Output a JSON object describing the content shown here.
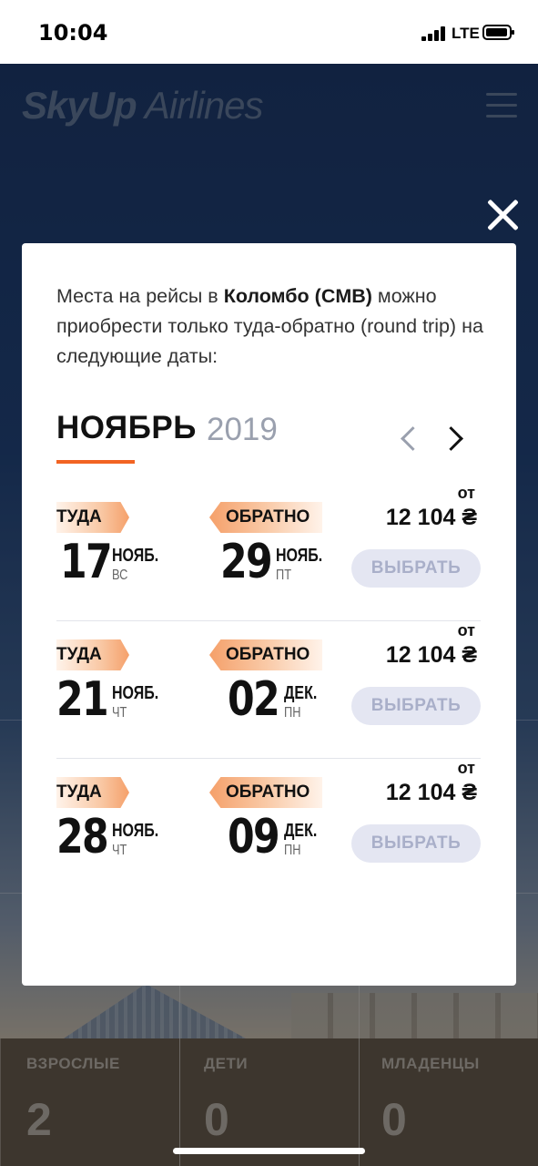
{
  "status_bar": {
    "time": "10:04",
    "network": "LTE"
  },
  "header": {
    "logo_sky": "SkyUp",
    "logo_airlines": " Airlines"
  },
  "background": {
    "passengers": [
      {
        "label": "ВЗРОСЛЫЕ",
        "value": "2"
      },
      {
        "label": "ДЕТИ",
        "value": "0"
      },
      {
        "label": "МЛАДЕНЦЫ",
        "value": "0"
      }
    ]
  },
  "modal": {
    "intro_pre": "Места на рейсы в ",
    "intro_bold": "Коломбо (CMB)",
    "intro_post": " можно приобрести только туда-обратно (round trip) на следующие даты:",
    "month": "НОЯБРЬ",
    "year": "2019",
    "flights": [
      {
        "out_tag": "ТУДА",
        "out_day": "17",
        "out_month": "НОЯБ.",
        "out_dow": "ВС",
        "back_tag": "ОБРАТНО",
        "back_day": "29",
        "back_month": "НОЯБ.",
        "back_dow": "ПТ",
        "from": "от",
        "price": "12 104 ₴",
        "button": "ВЫБРАТЬ"
      },
      {
        "out_tag": "ТУДА",
        "out_day": "21",
        "out_month": "НОЯБ.",
        "out_dow": "ЧТ",
        "back_tag": "ОБРАТНО",
        "back_day": "02",
        "back_month": "ДЕК.",
        "back_dow": "ПН",
        "from": "от",
        "price": "12 104 ₴",
        "button": "ВЫБРАТЬ"
      },
      {
        "out_tag": "ТУДА",
        "out_day": "28",
        "out_month": "НОЯБ.",
        "out_dow": "ЧТ",
        "back_tag": "ОБРАТНО",
        "back_day": "09",
        "back_month": "ДЕК.",
        "back_dow": "ПН",
        "from": "от",
        "price": "12 104 ₴",
        "button": "ВЫБРАТЬ"
      }
    ]
  },
  "colors": {
    "accent": "#f26322",
    "button_bg": "#e4e6f2",
    "button_text": "#a9afc9"
  }
}
